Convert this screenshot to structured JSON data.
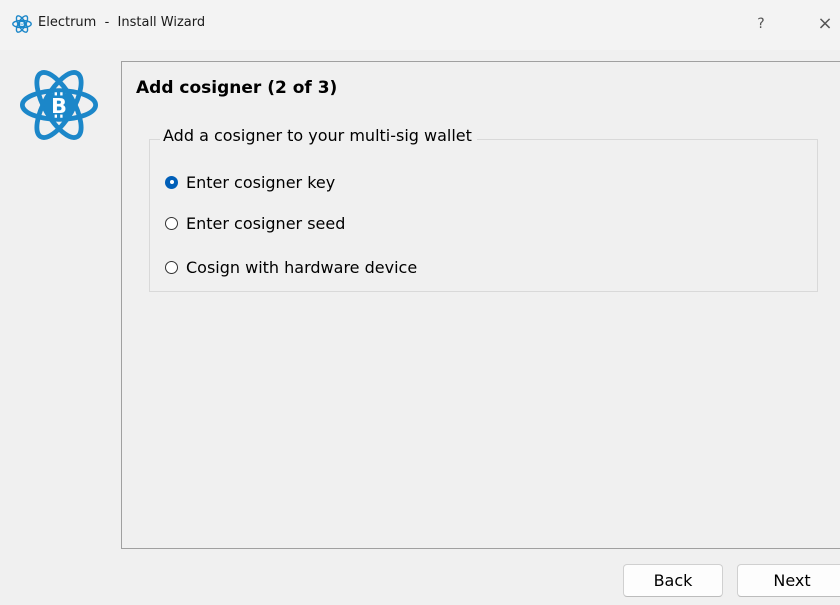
{
  "window": {
    "title": "Electrum  -  Install Wizard",
    "help_label": "?",
    "close_glyph": "×",
    "icon": "electrum-logo-icon"
  },
  "colors": {
    "brand_blue": "#1c87c9",
    "radio_checked": "#005fb8",
    "window_bg": "#f0f0f0"
  },
  "page": {
    "heading": "Add cosigner (2 of 3)",
    "group_title": "Add a cosigner to your multi-sig wallet",
    "options": [
      {
        "label": "Enter cosigner key",
        "selected": true
      },
      {
        "label": "Enter cosigner seed",
        "selected": false
      },
      {
        "label": "Cosign with hardware device",
        "selected": false
      }
    ]
  },
  "buttons": {
    "back_label": "Back",
    "next_label": "Next"
  }
}
